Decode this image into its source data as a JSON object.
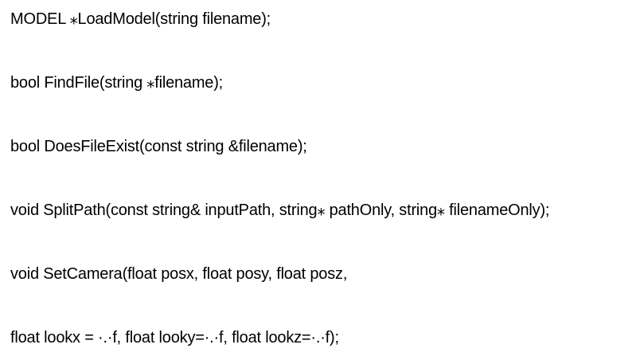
{
  "document": {
    "lines": [
      "MODEL ⁎LoadModel(string filename);",
      "bool FindFile(string ⁎filename);",
      "bool DoesFileExist(const string &filename);",
      "void SplitPath(const string& inputPath, string⁎ pathOnly, string⁎ filenameOnly);",
      "void SetCamera(float posx, float posy, float posz,",
      "float lookx = ·.·f, float looky=·.·f, float lookz=·.·f);"
    ]
  }
}
